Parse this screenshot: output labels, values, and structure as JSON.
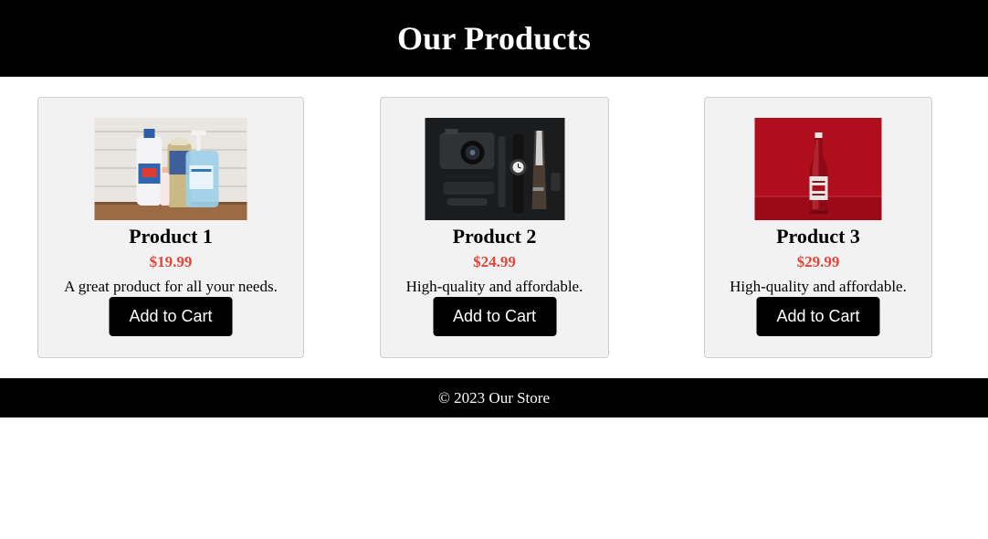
{
  "header": {
    "title": "Our Products"
  },
  "products": [
    {
      "name": "Product 1",
      "price": "$19.99",
      "description": "A great product for all your needs.",
      "button_label": "Add to Cart",
      "image": "cleaning-supplies-photo"
    },
    {
      "name": "Product 2",
      "price": "$24.99",
      "description": "High-quality and affordable.",
      "button_label": "Add to Cart",
      "image": "camera-gear-flatlay-photo"
    },
    {
      "name": "Product 3",
      "price": "$29.99",
      "description": "High-quality and affordable.",
      "button_label": "Add to Cart",
      "image": "soda-bottle-photo"
    }
  ],
  "footer": {
    "copyright": "© 2023 Our Store"
  },
  "colors": {
    "header_bg": "#000000",
    "card_bg": "#f2f2f2",
    "price": "#e2453a",
    "button_bg": "#000000"
  }
}
